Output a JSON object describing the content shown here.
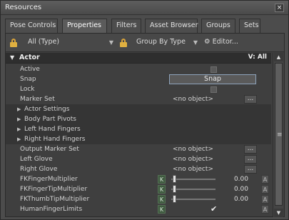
{
  "window": {
    "title": "Resources",
    "close_glyph": "×"
  },
  "tabs": [
    {
      "label": "Pose Controls"
    },
    {
      "label": "Properties"
    },
    {
      "label": "Filters"
    },
    {
      "label": "Asset Browser"
    },
    {
      "label": "Groups"
    },
    {
      "label": "Sets"
    }
  ],
  "toolbar": {
    "type_filter": "All (Type)",
    "group_by": "Group By Type",
    "editor_label": "Editor..."
  },
  "section": {
    "name": "Actor",
    "visibility": "V: All"
  },
  "rows": {
    "active": "Active",
    "snap": "Snap",
    "snap_button": "Snap",
    "lock": "Lock",
    "marker_set": "Marker Set",
    "marker_set_value": "<no object>",
    "actor_settings": "Actor Settings",
    "body_part_pivots": "Body Part Pivots",
    "left_hand_fingers": "Left Hand Fingers",
    "right_hand_fingers": "Right Hand Fingers",
    "output_marker_set": "Output Marker Set",
    "output_marker_set_value": "<no object>",
    "left_glove": "Left Glove",
    "left_glove_value": "<no object>",
    "right_glove": "Right Glove",
    "right_glove_value": "<no object>",
    "fk_finger_multiplier": "FKFingerMultiplier",
    "fk_finger_multiplier_value": "0.00",
    "fk_finger_tip_multiplier": "FKFingerTipMultiplier",
    "fk_finger_tip_multiplier_value": "0.00",
    "fk_thumb_tip_multiplier": "FKThumbTipMultiplier",
    "fk_thumb_tip_multiplier_value": "0.00",
    "human_finger_limits": "HumanFingerLimits"
  },
  "glyphs": {
    "dots": "...",
    "key": "K",
    "anim": "A",
    "check": "✔"
  }
}
